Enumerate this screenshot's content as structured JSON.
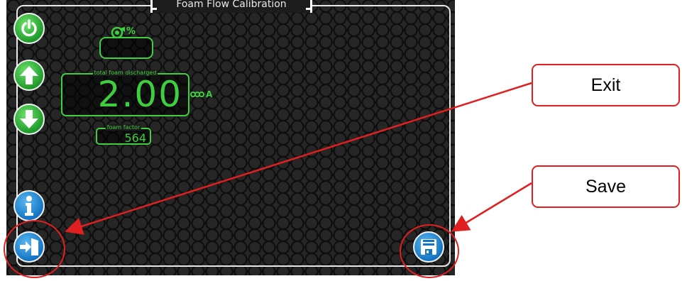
{
  "screen": {
    "title": "Foam Flow Calibration",
    "percent_label": "%",
    "total_foam": {
      "label": "total foam discharged",
      "value": "2.00",
      "unit": "A"
    },
    "foam_factor": {
      "label": "foam factor",
      "value": "564"
    }
  },
  "left_buttons": [
    {
      "name": "power",
      "icon": "power-icon",
      "color": "#1f9a2a"
    },
    {
      "name": "up",
      "icon": "arrow-up-icon",
      "color": "#1f9a2a"
    },
    {
      "name": "down",
      "icon": "arrow-down-icon",
      "color": "#1f9a2a"
    },
    {
      "name": "info",
      "icon": "info-icon",
      "color": "#1474c4"
    },
    {
      "name": "exit",
      "icon": "exit-door-icon",
      "color": "#1474c4"
    }
  ],
  "right_buttons": [
    {
      "name": "save",
      "icon": "floppy-disk-icon",
      "color": "#1474c4"
    }
  ],
  "callouts": {
    "exit": "Exit",
    "save": "Save"
  },
  "colors": {
    "accent_green": "#3fce3f",
    "annotation_red": "#e02020"
  }
}
